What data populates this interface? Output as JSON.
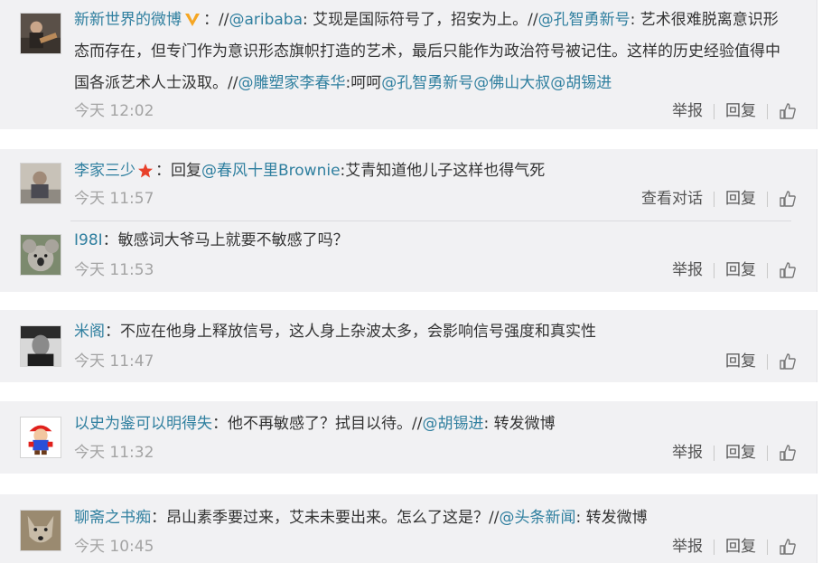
{
  "comments": [
    {
      "author": "新新世界的微博",
      "badge": "v-badge",
      "segments": [
        {
          "t": "：//"
        },
        {
          "m": "@aribaba"
        },
        {
          "t": ": 艾现是国际符号了，招安为上。//"
        },
        {
          "m": "@孔智勇新号"
        },
        {
          "t": ": 艺术很难脱离意识形态而存在，但专门作为意识形态旗帜打造的艺术，最后只能作为政治符号被记住。这样的历史经验值得中国各派艺术人士汲取。//"
        },
        {
          "m": "@雕塑家李春华"
        },
        {
          "t": ":呵呵"
        },
        {
          "m": "@孔智勇新号"
        },
        {
          "m": "@佛山大叔"
        },
        {
          "m": "@胡锡进"
        }
      ],
      "time": "今天 12:02",
      "actions": [
        "举报",
        "回复"
      ]
    },
    {
      "author": "李家三少",
      "badge": "star-badge",
      "segments": [
        {
          "t": "：回复"
        },
        {
          "m": "@春风十里Brownie"
        },
        {
          "t": ":艾青知道他儿子这样也得气死"
        }
      ],
      "time": "今天 11:57",
      "actions": [
        "查看对话",
        "回复"
      ]
    },
    {
      "author": "I98I",
      "segments": [
        {
          "t": "：敏感词大爷马上就要不敏感了吗？"
        }
      ],
      "time": "今天 11:53",
      "actions": [
        "举报",
        "回复"
      ]
    },
    {
      "author": "米阁",
      "segments": [
        {
          "t": "：不应在他身上释放信号，这人身上杂波太多，会影响信号强度和真实性"
        }
      ],
      "time": "今天 11:47",
      "actions": [
        "回复"
      ]
    },
    {
      "author": "以史为鉴可以明得失",
      "segments": [
        {
          "t": "：他不再敏感了？拭目以待。//"
        },
        {
          "m": "@胡锡进"
        },
        {
          "t": ": 转发微博"
        }
      ],
      "time": "今天 11:32",
      "actions": [
        "举报",
        "回复"
      ]
    },
    {
      "author": "聊斋之书痴",
      "segments": [
        {
          "t": "：昂山素季要过来，艾未未要出来。怎么了这是？//"
        },
        {
          "m": "@头条新闻"
        },
        {
          "t": ": 转发微博"
        }
      ],
      "time": "今天 10:45",
      "actions": [
        "举报",
        "回复"
      ]
    }
  ],
  "icons": {
    "like": "thumbs-up-icon",
    "avatar": "avatar-image"
  },
  "colors": {
    "link": "#2f7f9f",
    "background": "#f1f1f3",
    "time": "#a4a4a4",
    "v_badge": "#f5a623",
    "star_badge": "#e8402a"
  }
}
